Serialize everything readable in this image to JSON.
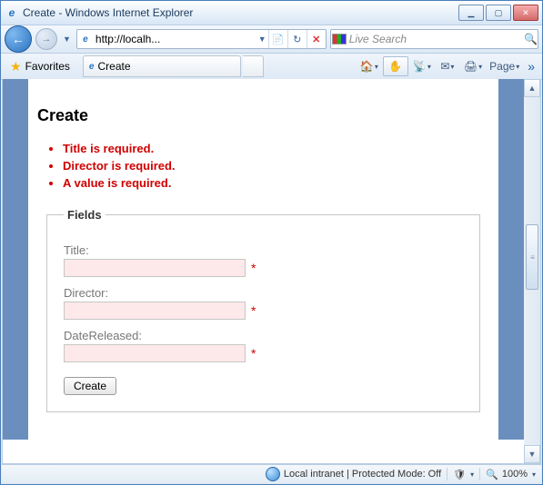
{
  "window": {
    "title": "Create - Windows Internet Explorer"
  },
  "nav": {
    "url_display": "http://localh...",
    "search_placeholder": "Live Search"
  },
  "toolbar": {
    "favorites_label": "Favorites",
    "tab_label": "Create",
    "page_menu_label": "Page"
  },
  "page": {
    "heading": "Create",
    "errors": [
      "Title is required.",
      "Director is required.",
      "A value is required."
    ],
    "legend": "Fields",
    "fields": {
      "title_label": "Title:",
      "director_label": "Director:",
      "datereleased_label": "DateReleased:"
    },
    "submit_label": "Create"
  },
  "status": {
    "zone_text": "Local intranet | Protected Mode: Off",
    "zoom_text": "100%"
  }
}
